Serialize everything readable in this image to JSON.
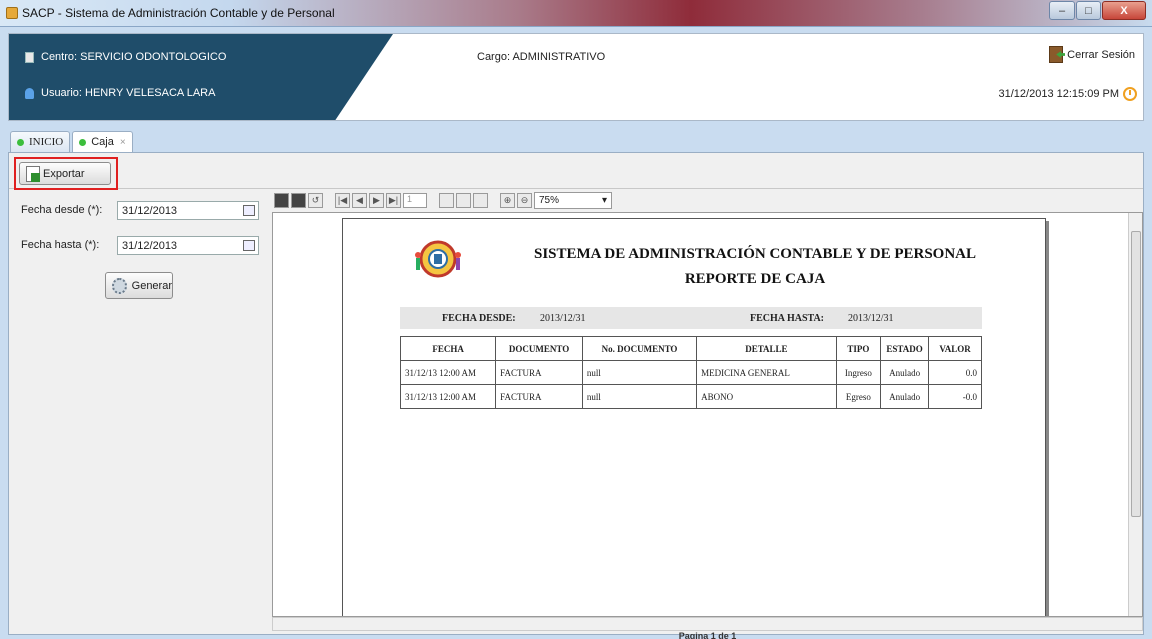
{
  "window": {
    "title": "SACP - Sistema de Administración Contable y de Personal",
    "controls": {
      "minimize": "–",
      "maximize": "□",
      "close": "X"
    }
  },
  "header": {
    "centro": "Centro: SERVICIO ODONTOLOGICO",
    "usuario": "Usuario: HENRY VELESACA LARA",
    "cargo": "Cargo:  ADMINISTRATIVO",
    "cerrar_sesion": "Cerrar Sesión",
    "datetime": "31/12/2013 12:15:09 PM"
  },
  "tabs": [
    {
      "label": "INICIO",
      "active": false
    },
    {
      "label": "Caja",
      "active": true,
      "close": "×"
    }
  ],
  "toolbar": {
    "export_label": "Exportar"
  },
  "params": {
    "fecha_desde_label": "Fecha desde (*):",
    "fecha_desde_value": "31/12/2013",
    "fecha_hasta_label": "Fecha hasta (*):",
    "fecha_hasta_value": "31/12/2013",
    "generar_label": "Generar"
  },
  "viewer": {
    "page_input": "1",
    "zoom": "75%",
    "status": "Pagina 1 de 1"
  },
  "report": {
    "title1": "SISTEMA DE ADMINISTRACIÓN CONTABLE Y DE PERSONAL",
    "title2": "REPORTE DE CAJA",
    "fecha_desde_label": "FECHA DESDE:",
    "fecha_desde": "2013/12/31",
    "fecha_hasta_label": "FECHA HASTA:",
    "fecha_hasta": "2013/12/31",
    "columns": [
      "FECHA",
      "DOCUMENTO",
      "No. DOCUMENTO",
      "DETALLE",
      "TIPO",
      "ESTADO",
      "VALOR"
    ],
    "rows": [
      [
        "31/12/13 12:00 AM",
        "FACTURA",
        "null",
        "MEDICINA GENERAL",
        "Ingreso",
        "Anulado",
        "0.0"
      ],
      [
        "31/12/13 12:00 AM",
        "FACTURA",
        "null",
        "ABONO",
        "Egreso",
        "Anulado",
        "-0.0"
      ]
    ]
  },
  "colors": {
    "header_dark": "#1f4d6a",
    "highlight": "#e02020",
    "tab_dot": "#3cbe3c"
  }
}
